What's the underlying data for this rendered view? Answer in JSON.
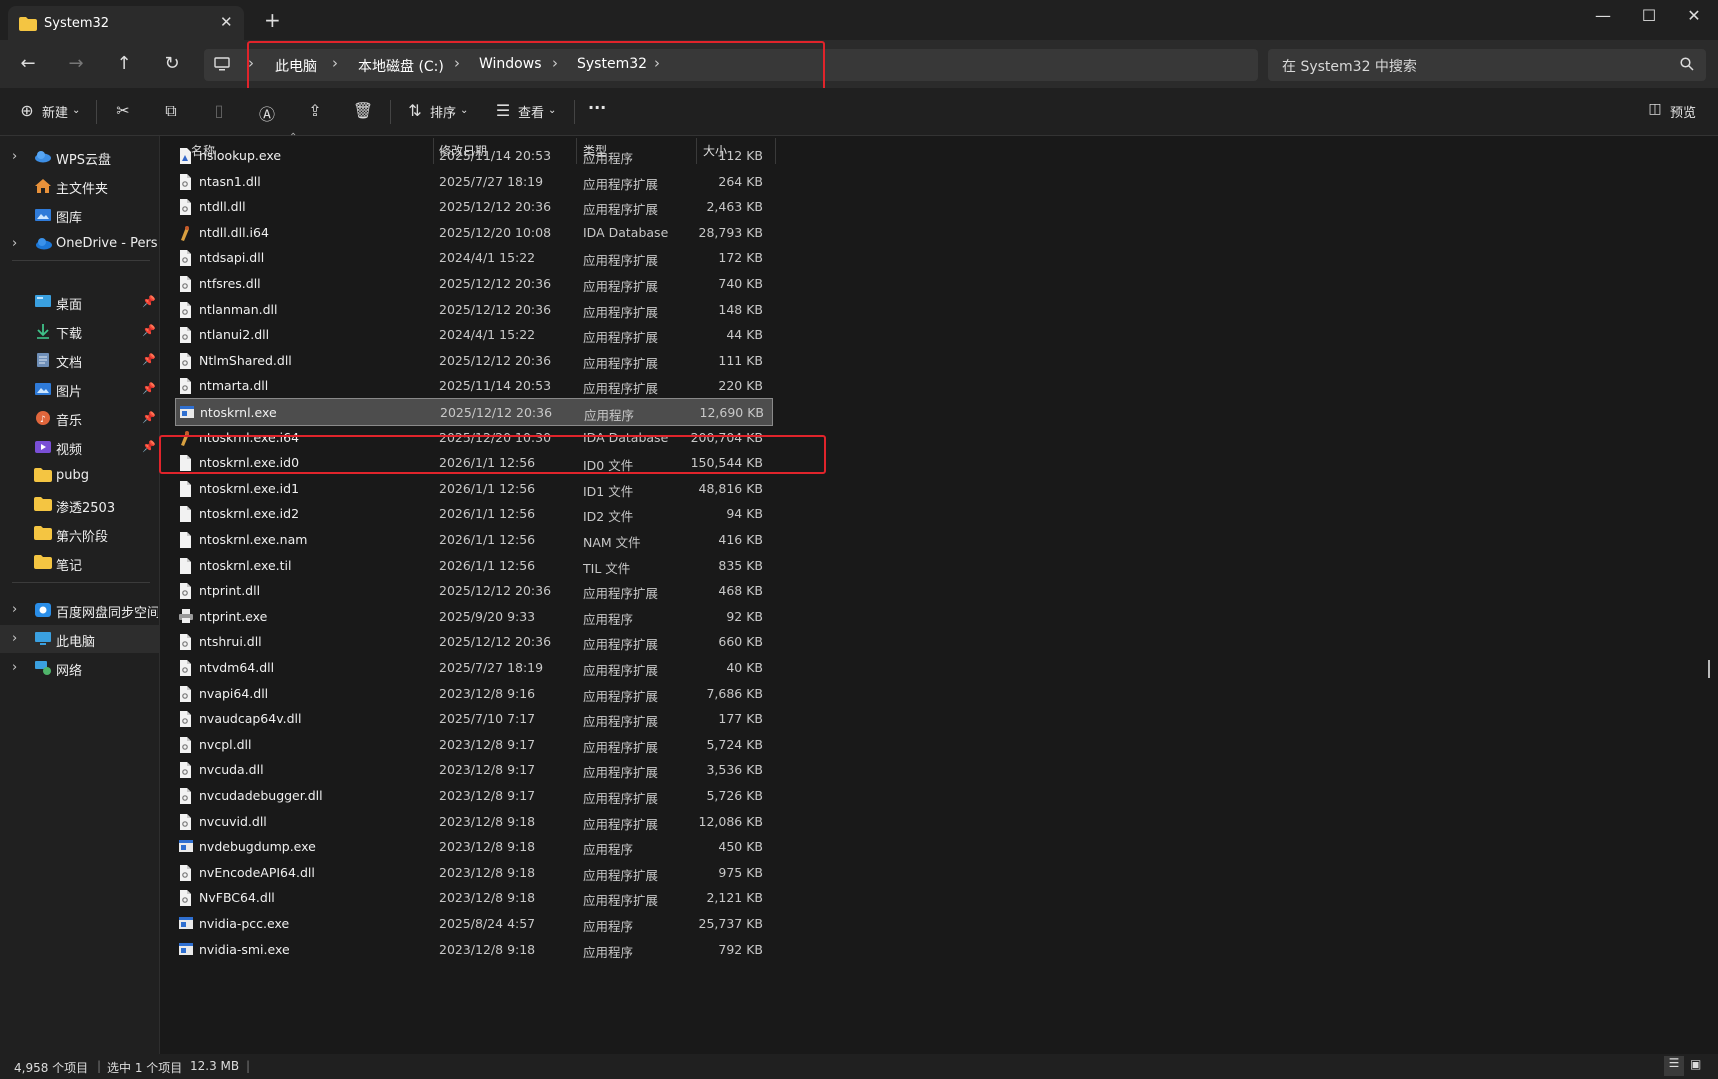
{
  "window": {
    "tab_title": "System32",
    "tab_close": "✕",
    "new_tab": "+",
    "controls": {
      "minimize": "—",
      "maximize": "☐",
      "close": "✕"
    }
  },
  "nav": {
    "back": "←",
    "forward": "→",
    "up": "↑",
    "refresh": "↻",
    "breadcrumb": [
      "此电脑",
      "本地磁盘 (C:)",
      "Windows",
      "System32"
    ],
    "search_placeholder": "在 System32 中搜索"
  },
  "toolbar": {
    "new_label": "新建",
    "sort_label": "排序",
    "view_label": "查看",
    "more_label": "···",
    "preview_label": "预览"
  },
  "sidebar": {
    "items": [
      {
        "label": "WPS云盘",
        "icon": "cloud-icon",
        "expandable": true
      },
      {
        "label": "主文件夹",
        "icon": "home-icon",
        "expandable": false
      },
      {
        "label": "图库",
        "icon": "gallery-icon",
        "expandable": false
      },
      {
        "label": "OneDrive - Perso",
        "icon": "onedrive-icon",
        "expandable": true
      },
      {
        "label": "桌面",
        "icon": "desktop-icon",
        "pinned": true
      },
      {
        "label": "下载",
        "icon": "download-icon",
        "pinned": true
      },
      {
        "label": "文档",
        "icon": "document-icon",
        "pinned": true
      },
      {
        "label": "图片",
        "icon": "pictures-icon",
        "pinned": true
      },
      {
        "label": "音乐",
        "icon": "music-icon",
        "pinned": true
      },
      {
        "label": "视频",
        "icon": "video-icon",
        "pinned": true
      },
      {
        "label": "pubg",
        "icon": "folder-icon"
      },
      {
        "label": "渗透2503",
        "icon": "folder-icon"
      },
      {
        "label": "第六阶段",
        "icon": "folder-icon"
      },
      {
        "label": "笔记",
        "icon": "folder-icon"
      },
      {
        "label": "百度网盘同步空间",
        "icon": "baidu-icon",
        "expandable": true
      },
      {
        "label": "此电脑",
        "icon": "this-pc-icon",
        "expandable": true,
        "selected": true
      },
      {
        "label": "网络",
        "icon": "network-icon",
        "expandable": true
      }
    ]
  },
  "columns": {
    "name": "名称",
    "date": "修改日期",
    "type": "类型",
    "size": "大小"
  },
  "files": [
    {
      "name": "nslookup.exe",
      "date": "2025/11/14 20:53",
      "type": "应用程序",
      "size": "112 KB",
      "icon": "exe-icon"
    },
    {
      "name": "ntasn1.dll",
      "date": "2025/7/27 18:19",
      "type": "应用程序扩展",
      "size": "264 KB",
      "icon": "dll-icon"
    },
    {
      "name": "ntdll.dll",
      "date": "2025/12/12 20:36",
      "type": "应用程序扩展",
      "size": "2,463 KB",
      "icon": "dll-icon"
    },
    {
      "name": "ntdll.dll.i64",
      "date": "2025/12/20 10:08",
      "type": "IDA Database",
      "size": "28,793 KB",
      "icon": "ida-icon"
    },
    {
      "name": "ntdsapi.dll",
      "date": "2024/4/1 15:22",
      "type": "应用程序扩展",
      "size": "172 KB",
      "icon": "dll-icon"
    },
    {
      "name": "ntfsres.dll",
      "date": "2025/12/12 20:36",
      "type": "应用程序扩展",
      "size": "740 KB",
      "icon": "dll-icon"
    },
    {
      "name": "ntlanman.dll",
      "date": "2025/12/12 20:36",
      "type": "应用程序扩展",
      "size": "148 KB",
      "icon": "dll-icon"
    },
    {
      "name": "ntlanui2.dll",
      "date": "2024/4/1 15:22",
      "type": "应用程序扩展",
      "size": "44 KB",
      "icon": "dll-icon"
    },
    {
      "name": "NtlmShared.dll",
      "date": "2025/12/12 20:36",
      "type": "应用程序扩展",
      "size": "111 KB",
      "icon": "dll-icon"
    },
    {
      "name": "ntmarta.dll",
      "date": "2025/11/14 20:53",
      "type": "应用程序扩展",
      "size": "220 KB",
      "icon": "dll-icon"
    },
    {
      "name": "ntoskrnl.exe",
      "date": "2025/12/12 20:36",
      "type": "应用程序",
      "size": "12,690 KB",
      "icon": "exe-window-icon",
      "selected": true
    },
    {
      "name": "ntoskrnl.exe.i64",
      "date": "2025/12/20 10:30",
      "type": "IDA Database",
      "size": "200,704 KB",
      "icon": "ida-icon"
    },
    {
      "name": "ntoskrnl.exe.id0",
      "date": "2026/1/1 12:56",
      "type": "ID0 文件",
      "size": "150,544 KB",
      "icon": "file-icon"
    },
    {
      "name": "ntoskrnl.exe.id1",
      "date": "2026/1/1 12:56",
      "type": "ID1 文件",
      "size": "48,816 KB",
      "icon": "file-icon"
    },
    {
      "name": "ntoskrnl.exe.id2",
      "date": "2026/1/1 12:56",
      "type": "ID2 文件",
      "size": "94 KB",
      "icon": "file-icon"
    },
    {
      "name": "ntoskrnl.exe.nam",
      "date": "2026/1/1 12:56",
      "type": "NAM 文件",
      "size": "416 KB",
      "icon": "file-icon"
    },
    {
      "name": "ntoskrnl.exe.til",
      "date": "2026/1/1 12:56",
      "type": "TIL 文件",
      "size": "835 KB",
      "icon": "file-icon"
    },
    {
      "name": "ntprint.dll",
      "date": "2025/12/12 20:36",
      "type": "应用程序扩展",
      "size": "468 KB",
      "icon": "dll-icon"
    },
    {
      "name": "ntprint.exe",
      "date": "2025/9/20 9:33",
      "type": "应用程序",
      "size": "92 KB",
      "icon": "printer-icon"
    },
    {
      "name": "ntshrui.dll",
      "date": "2025/12/12 20:36",
      "type": "应用程序扩展",
      "size": "660 KB",
      "icon": "dll-icon"
    },
    {
      "name": "ntvdm64.dll",
      "date": "2025/7/27 18:19",
      "type": "应用程序扩展",
      "size": "40 KB",
      "icon": "dll-icon"
    },
    {
      "name": "nvapi64.dll",
      "date": "2023/12/8 9:16",
      "type": "应用程序扩展",
      "size": "7,686 KB",
      "icon": "dll-icon"
    },
    {
      "name": "nvaudcap64v.dll",
      "date": "2025/7/10 7:17",
      "type": "应用程序扩展",
      "size": "177 KB",
      "icon": "dll-icon"
    },
    {
      "name": "nvcpl.dll",
      "date": "2023/12/8 9:17",
      "type": "应用程序扩展",
      "size": "5,724 KB",
      "icon": "dll-icon"
    },
    {
      "name": "nvcuda.dll",
      "date": "2023/12/8 9:17",
      "type": "应用程序扩展",
      "size": "3,536 KB",
      "icon": "dll-icon"
    },
    {
      "name": "nvcudadebugger.dll",
      "date": "2023/12/8 9:17",
      "type": "应用程序扩展",
      "size": "5,726 KB",
      "icon": "dll-icon"
    },
    {
      "name": "nvcuvid.dll",
      "date": "2023/12/8 9:18",
      "type": "应用程序扩展",
      "size": "12,086 KB",
      "icon": "dll-icon"
    },
    {
      "name": "nvdebugdump.exe",
      "date": "2023/12/8 9:18",
      "type": "应用程序",
      "size": "450 KB",
      "icon": "exe-window-icon"
    },
    {
      "name": "nvEncodeAPI64.dll",
      "date": "2023/12/8 9:18",
      "type": "应用程序扩展",
      "size": "975 KB",
      "icon": "dll-icon"
    },
    {
      "name": "NvFBC64.dll",
      "date": "2023/12/8 9:18",
      "type": "应用程序扩展",
      "size": "2,121 KB",
      "icon": "dll-icon"
    },
    {
      "name": "nvidia-pcc.exe",
      "date": "2025/8/24 4:57",
      "type": "应用程序",
      "size": "25,737 KB",
      "icon": "exe-window-icon"
    },
    {
      "name": "nvidia-smi.exe",
      "date": "2023/12/8 9:18",
      "type": "应用程序",
      "size": "792 KB",
      "icon": "exe-window-icon"
    }
  ],
  "status": {
    "item_count": "4,958 个项目",
    "selected": "选中 1 个项目",
    "selected_size": "12.3 MB"
  },
  "colors": {
    "highlight_box": "#e0242b",
    "folder": "#f4c542",
    "accent": "#4aa3ff"
  }
}
